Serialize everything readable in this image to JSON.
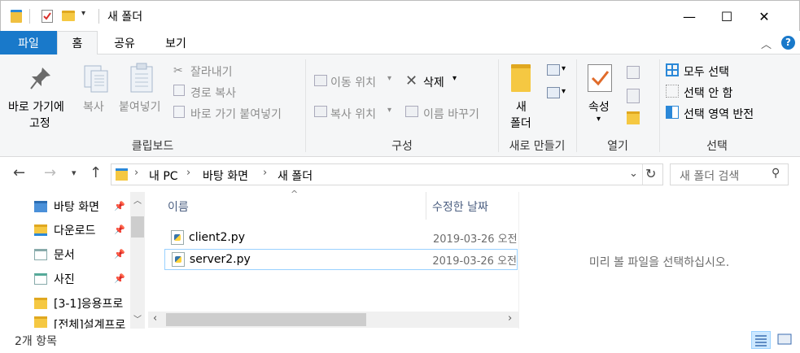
{
  "window": {
    "title": "새 폴더",
    "controls": {
      "minimize": "—",
      "maximize": "☐",
      "close": "✕"
    }
  },
  "tabs": [
    {
      "label": "파일"
    },
    {
      "label": "홈"
    },
    {
      "label": "공유"
    },
    {
      "label": "보기"
    }
  ],
  "ribbon": {
    "clipboard": {
      "group": "클립보드",
      "pin_label_1": "바로 가기에",
      "pin_label_2": "고정",
      "copy": "복사",
      "paste": "붙여넣기",
      "cut": "잘라내기",
      "copy_path": "경로 복사",
      "paste_shortcut": "바로 가기 붙여넣기"
    },
    "organize": {
      "group": "구성",
      "move_to": "이동 위치",
      "delete": "삭제",
      "copy_to": "복사 위치",
      "rename": "이름 바꾸기"
    },
    "new": {
      "group": "새로 만들기",
      "new_folder_1": "새",
      "new_folder_2": "폴더"
    },
    "open": {
      "group": "열기",
      "properties": "속성"
    },
    "select": {
      "group": "선택",
      "select_all": "모두 선택",
      "select_none": "선택 안 함",
      "invert": "선택 영역 반전"
    }
  },
  "address": {
    "breadcrumb": [
      "내 PC",
      "바탕 화면",
      "새 폴더"
    ],
    "search_placeholder": "새 폴더 검색"
  },
  "nav": {
    "items": [
      {
        "label": "바탕 화면",
        "pinned": true
      },
      {
        "label": "다운로드",
        "pinned": true
      },
      {
        "label": "문서",
        "pinned": true
      },
      {
        "label": "사진",
        "pinned": true
      },
      {
        "label": "[3-1]응용프로",
        "pinned": false
      },
      {
        "label": "[전체]설계프로",
        "pinned": false
      }
    ]
  },
  "files": {
    "columns": {
      "name": "이름",
      "modified": "수정한 날짜"
    },
    "rows": [
      {
        "name": "client2.py",
        "modified": "2019-03-26 오전"
      },
      {
        "name": "server2.py",
        "modified": "2019-03-26 오전"
      }
    ]
  },
  "preview": {
    "message": "미리 볼 파일을 선택하십시오."
  },
  "status": {
    "count": "2개 항목"
  },
  "colors": {
    "file_tab": "#1979ca",
    "ribbon_bg": "#f5f6f7",
    "selection_border": "#99d1ff",
    "column_header": "#4d6082"
  }
}
